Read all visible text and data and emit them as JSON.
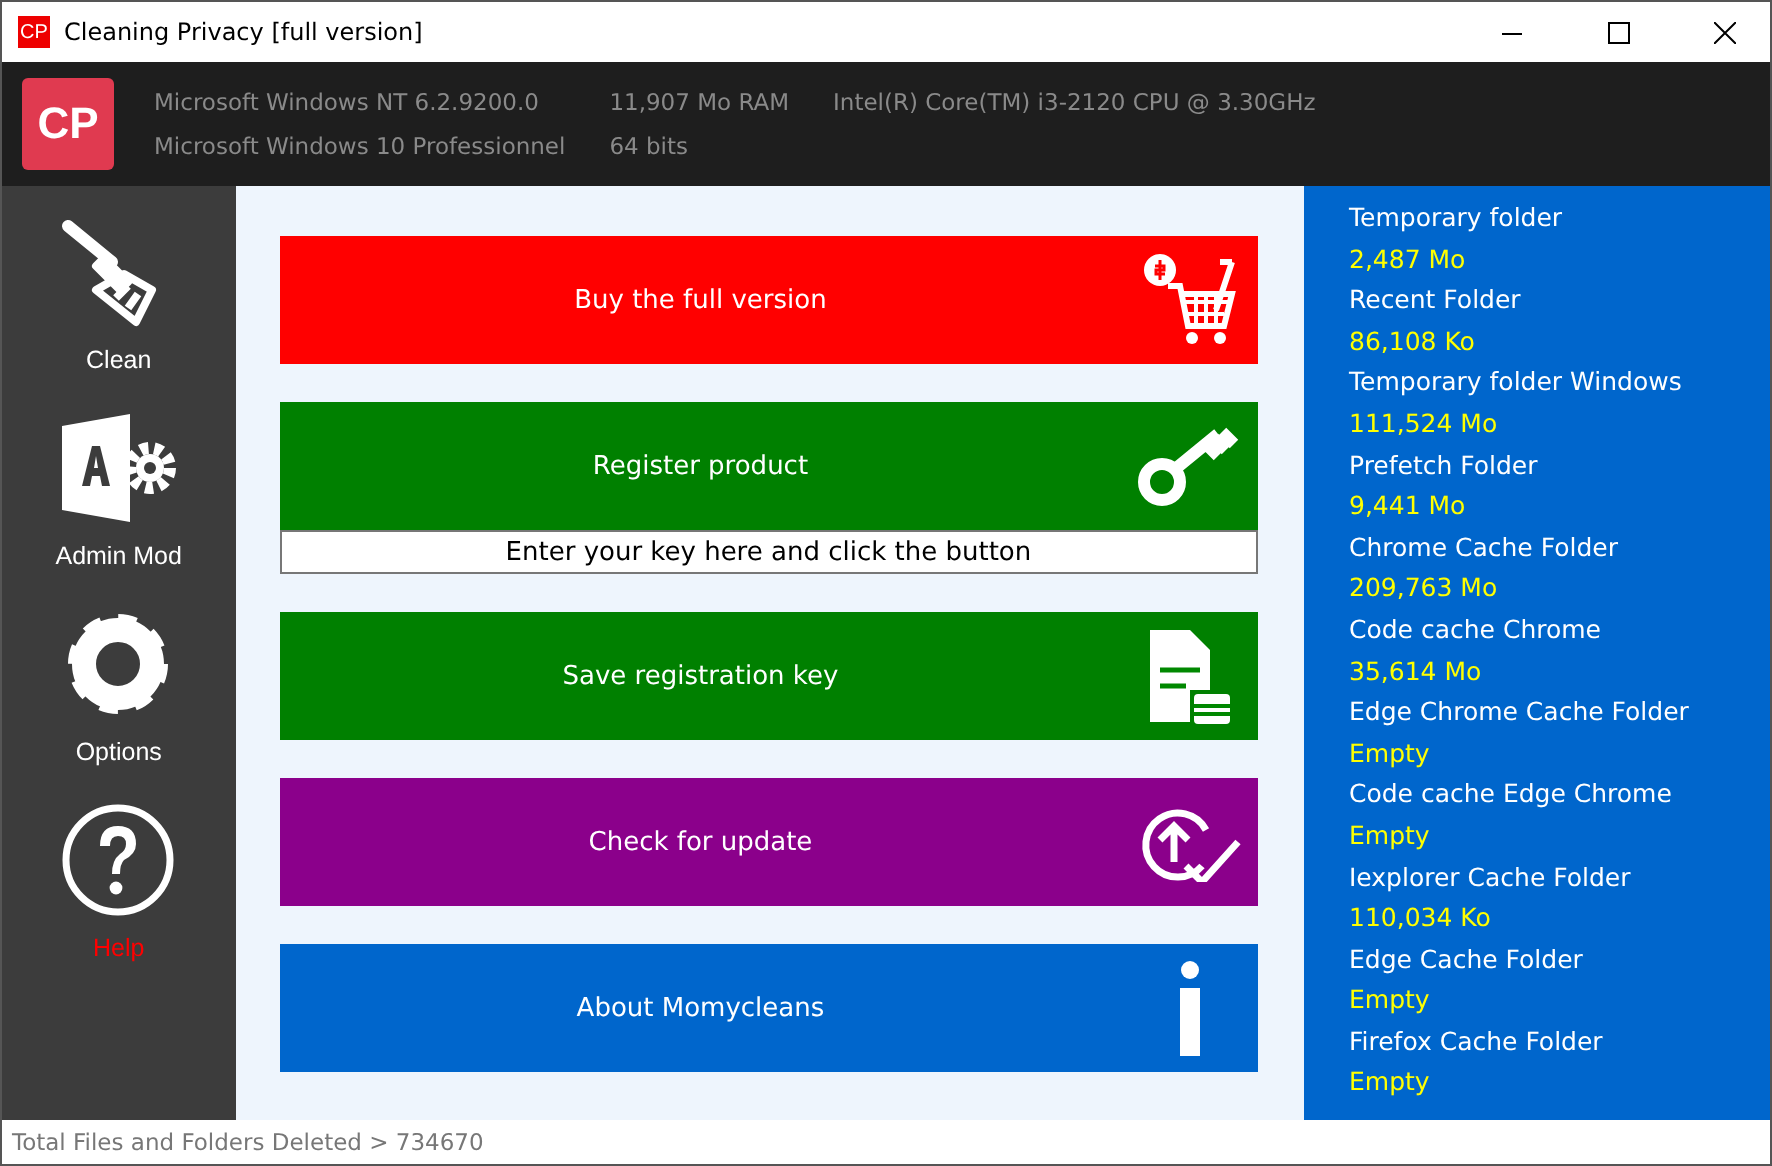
{
  "window": {
    "title": "Cleaning Privacy [full version]",
    "app_icon": "CP"
  },
  "header": {
    "logo": "CP",
    "info": [
      "Microsoft Windows NT 6.2.9200.0",
      "11,907 Mo RAM",
      "Intel(R) Core(TM) i3-2120 CPU @ 3.30GHz",
      "Microsoft Windows 10 Professionnel",
      "64 bits"
    ]
  },
  "sidebar": {
    "items": [
      {
        "kind": "broom",
        "label": "Clean",
        "color": "#ffffff"
      },
      {
        "kind": "admin",
        "label": "Admin Mod",
        "color": "#ffffff"
      },
      {
        "kind": "gear",
        "label": "Options",
        "color": "#ffffff"
      },
      {
        "kind": "help",
        "label": "Help",
        "color": "#ff0000"
      }
    ]
  },
  "actions": [
    {
      "kind": "cart",
      "label": "Buy the full version",
      "color": "#ff0000"
    },
    {
      "kind": "key",
      "label": "Register product",
      "color": "#008000",
      "placeholder": "Enter your key here and click the button"
    },
    {
      "kind": "document",
      "label": "Save registration key",
      "color": "#008000"
    },
    {
      "kind": "update",
      "label": "Check for update",
      "color": "#8b008b"
    },
    {
      "kind": "info",
      "label": "About Momycleans",
      "color": "#0066cc"
    }
  ],
  "folders": [
    {
      "name": "Temporary folder",
      "size": "2,487 Mo"
    },
    {
      "name": "Recent Folder",
      "size": "86,108 Ko"
    },
    {
      "name": "Temporary folder Windows",
      "size": "111,524 Mo"
    },
    {
      "name": "Prefetch Folder",
      "size": "9,441 Mo"
    },
    {
      "name": "Chrome Cache Folder",
      "size": "209,763 Mo"
    },
    {
      "name": "Code cache Chrome",
      "size": "35,614 Mo"
    },
    {
      "name": "Edge Chrome Cache Folder",
      "size": "Empty"
    },
    {
      "name": "Code cache Edge Chrome",
      "size": "Empty"
    },
    {
      "name": "Iexplorer Cache Folder",
      "size": "110,034 Ko"
    },
    {
      "name": "Edge Cache Folder",
      "size": "Empty"
    },
    {
      "name": "Firefox Cache Folder",
      "size": "Empty"
    }
  ],
  "status_bar": "Total Files and Folders Deleted > 734670"
}
